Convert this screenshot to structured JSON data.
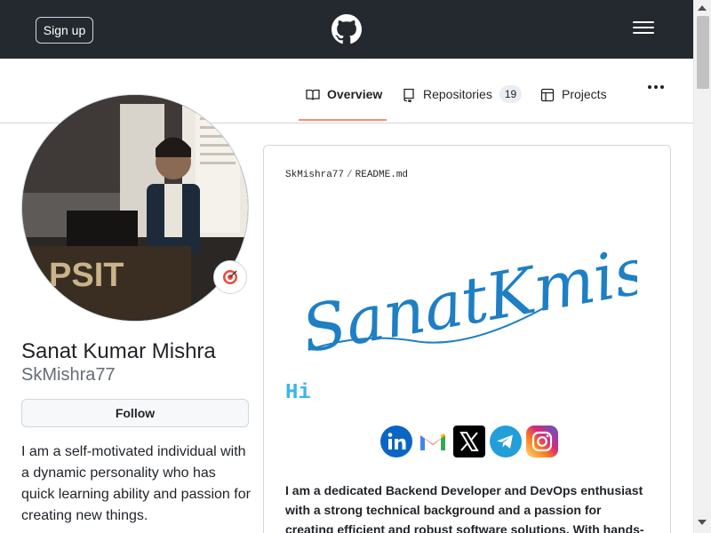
{
  "header": {
    "signup_label": "Sign up"
  },
  "tabs": [
    {
      "label": "Overview",
      "icon": "book-icon",
      "selected": true
    },
    {
      "label": "Repositories",
      "icon": "repo-icon",
      "count": "19"
    },
    {
      "label": "Projects",
      "icon": "table-icon"
    }
  ],
  "profile": {
    "full_name": "Sanat Kumar Mishra",
    "username": "SkMishra77",
    "follow_label": "Follow",
    "bio": "I am a self-motivated individual with a dynamic personality who has quick learning ability and passion for creating new things.",
    "avatar_banner_text": "PSIT",
    "avatar_lectern_text": "PSIT"
  },
  "readme": {
    "owner": "SkMishra77",
    "separator": "/",
    "file": "README.md",
    "signature_text": "SanatKmishra",
    "greeting": "Hi",
    "socials": [
      "linkedin-icon",
      "gmail-icon",
      "x-icon",
      "telegram-icon",
      "instagram-icon"
    ],
    "intro": "I am a dedicated Backend Developer and DevOps enthusiast with a strong technical background and a passion for creating efficient and robust software solutions. With hands-on"
  },
  "colors": {
    "header_bg": "#24292f",
    "tab_underline": "#fd8c73",
    "greeting": "#3db5ea",
    "signature": "#1e7fc4"
  }
}
